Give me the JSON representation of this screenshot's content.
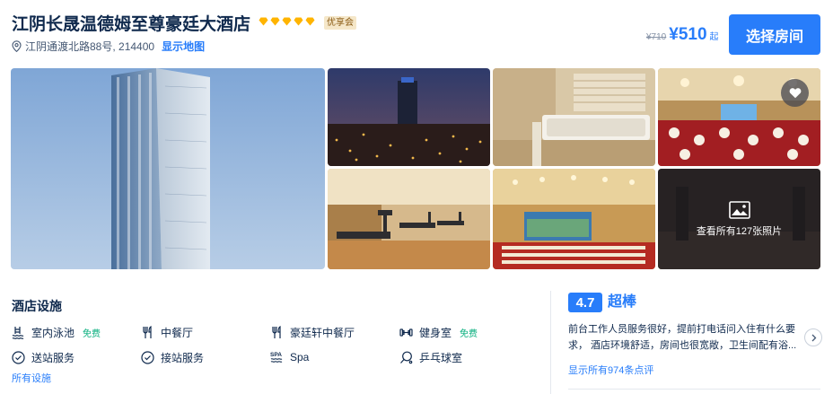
{
  "hotel": {
    "name": "江阴长晟温德姆至尊豪廷大酒店",
    "star_count": 5,
    "badge": "优享会",
    "address": "江阴通渡北路88号, 214400",
    "show_map": "显示地图"
  },
  "pricing": {
    "original": "¥710",
    "current": "¥510",
    "suffix": "起",
    "select_label": "选择房间"
  },
  "gallery": {
    "more_photos_label": "查看所有127张照片"
  },
  "facilities": {
    "title": "酒店设施",
    "items": [
      {
        "label": "室内泳池",
        "tag": "免费",
        "icon": "pool-icon"
      },
      {
        "label": "中餐厅",
        "tag": "",
        "icon": "restaurant-icon"
      },
      {
        "label": "豪廷轩中餐厅",
        "tag": "",
        "icon": "restaurant-icon"
      },
      {
        "label": "健身室",
        "tag": "免费",
        "icon": "dumbbell-icon"
      },
      {
        "label": "送站服务",
        "tag": "",
        "icon": "check-circle-icon"
      },
      {
        "label": "接站服务",
        "tag": "",
        "icon": "check-circle-icon"
      },
      {
        "label": "Spa",
        "tag": "",
        "icon": "spa-icon"
      },
      {
        "label": "乒乓球室",
        "tag": "",
        "icon": "ping-pong-icon"
      }
    ],
    "all_label": "所有设施"
  },
  "reviews": {
    "score": "4.7",
    "score_label": "超棒",
    "snippet": "前台工作人员服务很好，提前打电话问入住有什么要求， 酒店环境舒适，房间也很宽敞，卫生间配有浴...",
    "all_label": "显示所有974条点评"
  },
  "colors": {
    "accent": "#287dfa",
    "text": "#0f294d",
    "star": "#ffb400",
    "free": "#06ae7c"
  }
}
